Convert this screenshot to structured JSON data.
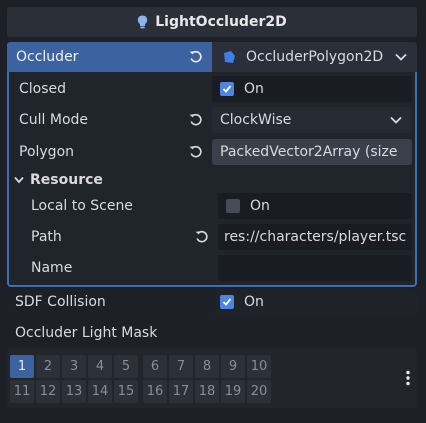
{
  "header": {
    "title": "LightOccluder2D"
  },
  "occluder": {
    "label": "Occluder",
    "value": "OccluderPolygon2D",
    "closed": {
      "label": "Closed",
      "checked": true,
      "value": "On"
    },
    "cull_mode": {
      "label": "Cull Mode",
      "value": "ClockWise"
    },
    "polygon": {
      "label": "Polygon",
      "value": "PackedVector2Array (size"
    },
    "resource": {
      "label": "Resource",
      "local_to_scene": {
        "label": "Local to Scene",
        "checked": false,
        "value": "On"
      },
      "path": {
        "label": "Path",
        "value": "res://characters/player.tsc"
      },
      "name": {
        "label": "Name",
        "value": ""
      }
    }
  },
  "sdf_collision": {
    "label": "SDF Collision",
    "checked": true,
    "value": "On"
  },
  "light_mask": {
    "label": "Occluder Light Mask",
    "bits": [
      "1",
      "2",
      "3",
      "4",
      "5",
      "6",
      "7",
      "8",
      "9",
      "10",
      "11",
      "12",
      "13",
      "14",
      "15",
      "16",
      "17",
      "18",
      "19",
      "20"
    ],
    "active_bits": [
      "1"
    ]
  },
  "colors": {
    "accent": "#3c63a0",
    "checkbox_on": "#4d86e0",
    "panel_border": "#3b6fb3",
    "background": "#1d2026"
  },
  "icons": {
    "header": "light-occluder-icon",
    "resource": "occluder-polygon-icon",
    "revert": "revert-icon",
    "more": "kebab-menu-icon"
  }
}
